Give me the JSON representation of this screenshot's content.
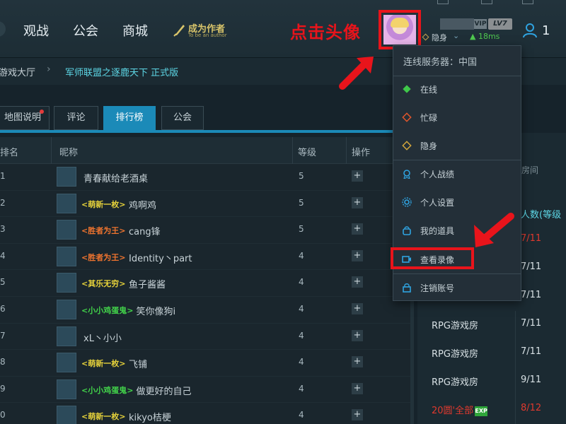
{
  "nav": {
    "items": [
      "观战",
      "公会",
      "商城"
    ],
    "author_main": "成为作者",
    "author_sub": "To be an author"
  },
  "annotation": {
    "click_avatar": "点击头像"
  },
  "user": {
    "vip": "VIP",
    "level": "LV7",
    "status": "隐身",
    "ping": "18ms",
    "count": "1"
  },
  "breadcrumb": {
    "home": "游戏大厅",
    "current": "军师联盟之逐鹿天下 正式版"
  },
  "tabs": [
    "地图说明",
    "评论",
    "排行榜",
    "公会"
  ],
  "table": {
    "headers": [
      "排名",
      "昵称",
      "等级",
      "操作"
    ],
    "rows": [
      {
        "rank": "1",
        "tag": "",
        "tag_color": "",
        "name": "青春献给老酒桌",
        "level": "5"
      },
      {
        "rank": "2",
        "tag": "<萌新一枚>",
        "tag_color": "#e7d33b",
        "name": "鸡啊鸡",
        "level": "5"
      },
      {
        "rank": "3",
        "tag": "<胜者为王>",
        "tag_color": "#f0742e",
        "name": "cang锋",
        "level": "5"
      },
      {
        "rank": "4",
        "tag": "<胜者为王>",
        "tag_color": "#f0742e",
        "name": "Identity丶part",
        "level": "4"
      },
      {
        "rank": "5",
        "tag": "<其乐无穷>",
        "tag_color": "#e7d33b",
        "name": "鱼子酱酱",
        "level": "4"
      },
      {
        "rank": "6",
        "tag": "<小小鸡蛋鬼>",
        "tag_color": "#42d24a",
        "name": "笑你像狗i",
        "level": "4"
      },
      {
        "rank": "7",
        "tag": "",
        "tag_color": "",
        "name": "xL丶小小",
        "level": "4"
      },
      {
        "rank": "8",
        "tag": "<萌新一枚>",
        "tag_color": "#e7d33b",
        "name": "飞铺",
        "level": "4"
      },
      {
        "rank": "9",
        "tag": "<小小鸡蛋鬼>",
        "tag_color": "#42d24a",
        "name": "做更好的自己",
        "level": "4"
      },
      {
        "rank": "0",
        "tag": "<萌新一枚>",
        "tag_color": "#e7d33b",
        "name": "kikyo桔梗",
        "level": "4"
      }
    ],
    "op_symbol": "+"
  },
  "right_panel": {
    "room_placeholder": "房间",
    "count_header": "人数(等级",
    "rows": [
      {
        "name": "",
        "count": "7/11",
        "red": true
      },
      {
        "name": "",
        "count": "7/11",
        "red": false
      },
      {
        "name": "",
        "count": "7/11",
        "red": false
      },
      {
        "name": "RPG游戏房",
        "count": "7/11",
        "red": false
      },
      {
        "name": "RPG游戏房",
        "count": "7/11",
        "red": false
      },
      {
        "name": "RPG游戏房",
        "count": "9/11",
        "red": false
      },
      {
        "name": "20圆'全部",
        "count": "8/12",
        "red": true,
        "exp": "EXP"
      }
    ]
  },
  "dropdown": {
    "server": "连线服务器：中国",
    "items": [
      {
        "label": "在线",
        "icon": "diamond-green-icon"
      },
      {
        "label": "忙碌",
        "icon": "diamond-red-icon"
      },
      {
        "label": "隐身",
        "icon": "diamond-yellow-icon"
      },
      {
        "label": "个人战绩",
        "icon": "medal-icon"
      },
      {
        "label": "个人设置",
        "icon": "gear-icon"
      },
      {
        "label": "我的道具",
        "icon": "bag-icon"
      },
      {
        "label": "查看录像",
        "icon": "video-icon"
      },
      {
        "label": "注销账号",
        "icon": "lock-icon"
      }
    ]
  },
  "colors": {
    "accent": "#1b8ab8",
    "annotation_red": "#e8141b",
    "cyan": "#5dd7e6"
  }
}
